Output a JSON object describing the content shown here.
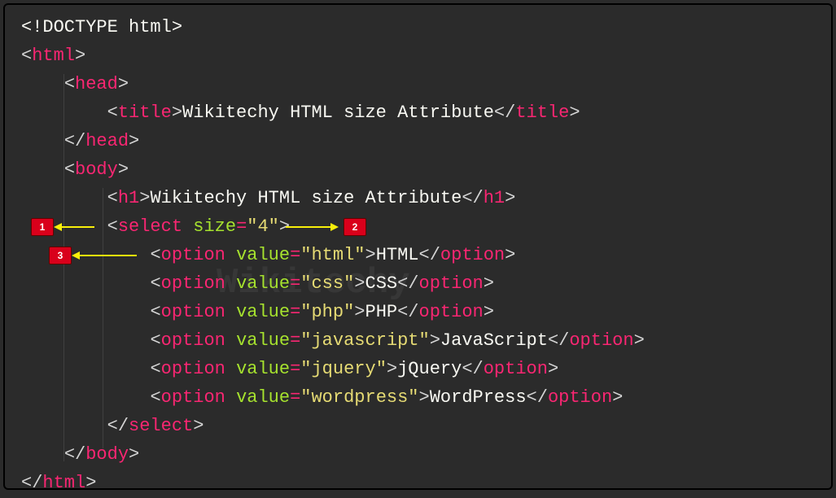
{
  "code": {
    "doctype": "<!DOCTYPE html>",
    "html_open": "html",
    "head_open": "head",
    "title_tag": "title",
    "title_text": "Wikitechy HTML size Attribute",
    "head_close": "head",
    "body_open": "body",
    "h1_tag": "h1",
    "h1_text": "Wikitechy HTML size Attribute",
    "select_tag": "select",
    "select_attr": "size",
    "select_val": "\"4\"",
    "options": [
      {
        "value": "\"html\"",
        "label": "HTML"
      },
      {
        "value": "\"css\"",
        "label": "CSS"
      },
      {
        "value": "\"php\"",
        "label": "PHP"
      },
      {
        "value": "\"javascript\"",
        "label": "JavaScript"
      },
      {
        "value": "\"jquery\"",
        "label": "jQuery"
      },
      {
        "value": "\"wordpress\"",
        "label": "WordPress"
      }
    ],
    "option_tag": "option",
    "option_attr": "value",
    "select_close": "select",
    "body_close": "body",
    "html_close": "html"
  },
  "callouts": {
    "c1": "1",
    "c2": "2",
    "c3": "3"
  },
  "watermark": "Wikitechy"
}
